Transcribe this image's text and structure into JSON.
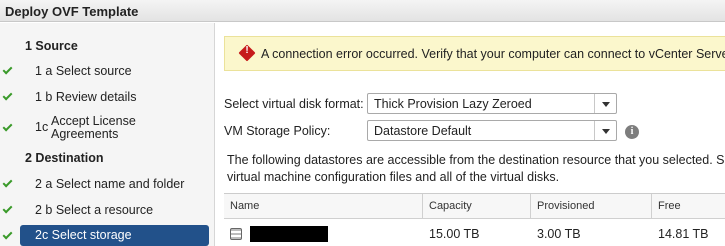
{
  "window": {
    "title": "Deploy OVF Template"
  },
  "steps": [
    {
      "label": "1  Source"
    },
    {
      "label": "1 a  Select source"
    },
    {
      "label": "1 b  Review details"
    },
    {
      "num": "1c",
      "label": "Accept License Agreements"
    },
    {
      "label": "2  Destination"
    },
    {
      "label": "2 a  Select name and folder"
    },
    {
      "label": "2 b  Select a resource"
    },
    {
      "label": "2c  Select storage"
    }
  ],
  "alert": {
    "message": "A connection error occurred. Verify that your computer can connect to vCenter Server.",
    "icon": "error-icon"
  },
  "disk_format": {
    "label": "Select virtual disk format:",
    "value": "Thick Provision Lazy Zeroed"
  },
  "storage_policy": {
    "label": "VM Storage Policy:",
    "value": "Datastore Default"
  },
  "description": {
    "line1": "The following datastores are accessible from the destination resource that you selected. Se",
    "line2": "virtual machine configuration files and all of the virtual disks."
  },
  "table": {
    "headers": [
      "Name",
      "Capacity",
      "Provisioned",
      "Free"
    ],
    "rows": [
      {
        "capacity": "15.00 TB",
        "provisioned": "3.00 TB",
        "free": "14.81 TB"
      }
    ]
  },
  "colors": {
    "active_step": "#22518a",
    "check": "#3a9a2a",
    "alert_bg": "#fbf7cc",
    "error": "#c61b1b"
  }
}
